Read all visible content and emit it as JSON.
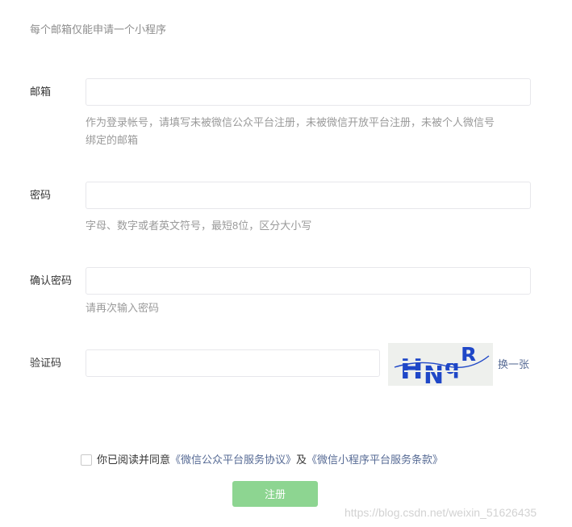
{
  "notice": "每个邮箱仅能申请一个小程序",
  "email": {
    "label": "邮箱",
    "value": "",
    "placeholder": "",
    "tip_line1": "作为登录帐号，请填写未被微信公众平台注册，未被微信开放平台注册，未被个人微信号",
    "tip_line2": "绑定的邮箱"
  },
  "password": {
    "label": "密码",
    "value": "",
    "placeholder": "",
    "tip": "字母、数字或者英文符号，最短8位，区分大小写"
  },
  "confirm_password": {
    "label": "确认密码",
    "value": "",
    "placeholder": "",
    "tip": "请再次输入密码"
  },
  "captcha": {
    "label": "验证码",
    "value": "",
    "placeholder": "",
    "image_text": "HNqR",
    "change_label": "换一张"
  },
  "agreement": {
    "checked": false,
    "prefix": "你已阅读并同意",
    "link1": "《微信公众平台服务协议》",
    "connector": "及",
    "link2": "《微信小程序平台服务条款》"
  },
  "submit_label": "注册",
  "watermark": "https://blog.csdn.net/weixin_51626435",
  "colors": {
    "submit_bg": "#8dd591",
    "link": "#576b95",
    "border": "#e7e7eb"
  }
}
